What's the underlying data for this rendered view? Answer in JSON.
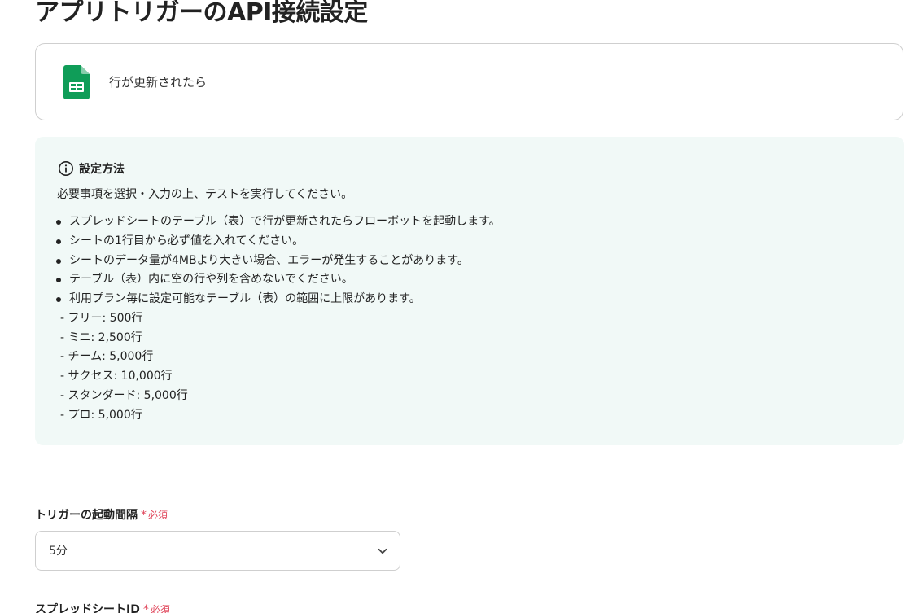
{
  "page": {
    "title": "アプリトリガーのAPI接続設定"
  },
  "trigger": {
    "icon": "google-sheets-icon",
    "label": "行が更新されたら"
  },
  "info": {
    "icon": "info-circle-icon",
    "title": "設定方法",
    "intro": "必要事項を選択・入力の上、テストを実行してください。",
    "bullets": [
      "スプレッドシートのテーブル（表）で行が更新されたらフローボットを起動します。",
      "シートの1行目から必ず値を入れてください。",
      "シートのデータ量が4MBより大きい場合、エラーが発生することがあります。",
      "テーブル（表）内に空の行や列を含めないでください。",
      "利用プラン毎に設定可能なテーブル（表）の範囲に上限があります。"
    ],
    "plans": [
      "- フリー: 500行",
      "- ミニ: 2,500行",
      "- チーム: 5,000行",
      "- サクセス: 10,000行",
      "- スタンダード: 5,000行",
      "- プロ: 5,000行"
    ]
  },
  "fields": {
    "interval": {
      "label": "トリガーの起動間隔",
      "required_mark": "*",
      "required_text": "必須",
      "value": "5分"
    },
    "spreadsheet_id": {
      "label": "スプレッドシートID",
      "required_mark": "*",
      "required_text": "必須"
    }
  },
  "colors": {
    "required": "#e0455a",
    "info_background": "#f1f9f7",
    "sheets_green": "#0f9d58"
  }
}
